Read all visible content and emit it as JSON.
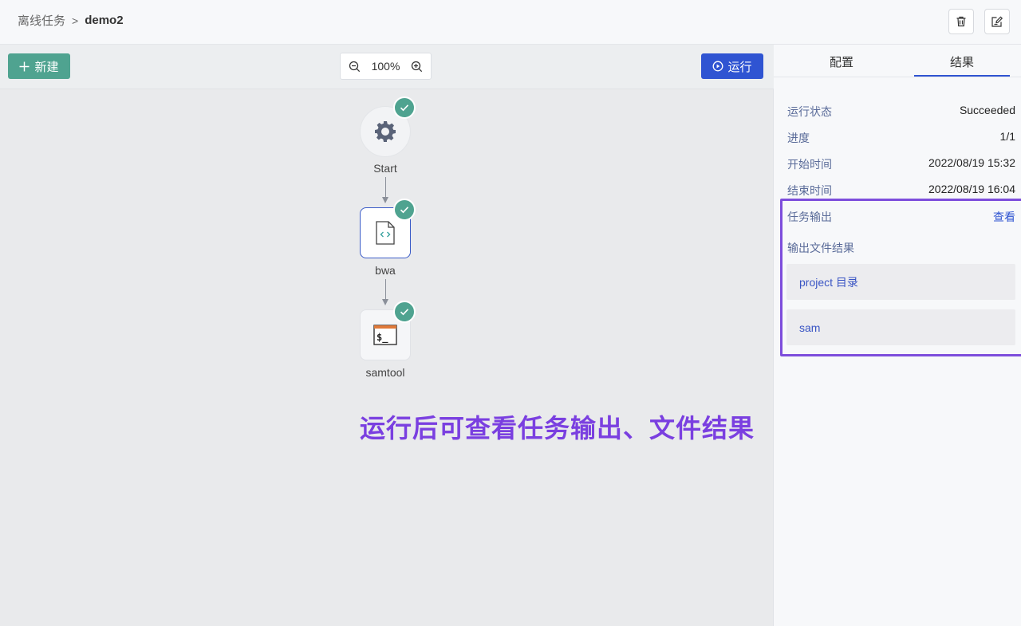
{
  "breadcrumb": {
    "parent": "离线任务",
    "separator": ">",
    "current": "demo2"
  },
  "header": {
    "delete_icon": "trash-icon",
    "edit_icon": "edit-icon"
  },
  "toolbar": {
    "new_label": "新建",
    "zoom_level": "100%",
    "run_label": "运行"
  },
  "nodes": [
    {
      "name": "Start",
      "icon": "gear-icon",
      "status": "success"
    },
    {
      "name": "bwa",
      "icon": "code-file-icon",
      "status": "success"
    },
    {
      "name": "samtool",
      "icon": "terminal-icon",
      "status": "success"
    }
  ],
  "annotation": "运行后可查看任务输出、文件结果",
  "panel": {
    "tabs": [
      {
        "label": "配置"
      },
      {
        "label": "结果"
      }
    ],
    "active_tab": "结果",
    "fields": [
      {
        "key": "运行状态",
        "value": "Succeeded"
      },
      {
        "key": "进度",
        "value": "1/1"
      },
      {
        "key": "开始时间",
        "value": "2022/08/19 15:32"
      },
      {
        "key": "结束时间",
        "value": "2022/08/19 16:04"
      }
    ],
    "task_output": {
      "label": "任务输出",
      "link": "查看"
    },
    "output_files": {
      "label": "输出文件结果",
      "items": [
        "project 目录",
        "sam"
      ]
    }
  },
  "colors": {
    "accent": "#2f54d2",
    "success": "#4fa390",
    "annotation": "#7a3fe0"
  }
}
